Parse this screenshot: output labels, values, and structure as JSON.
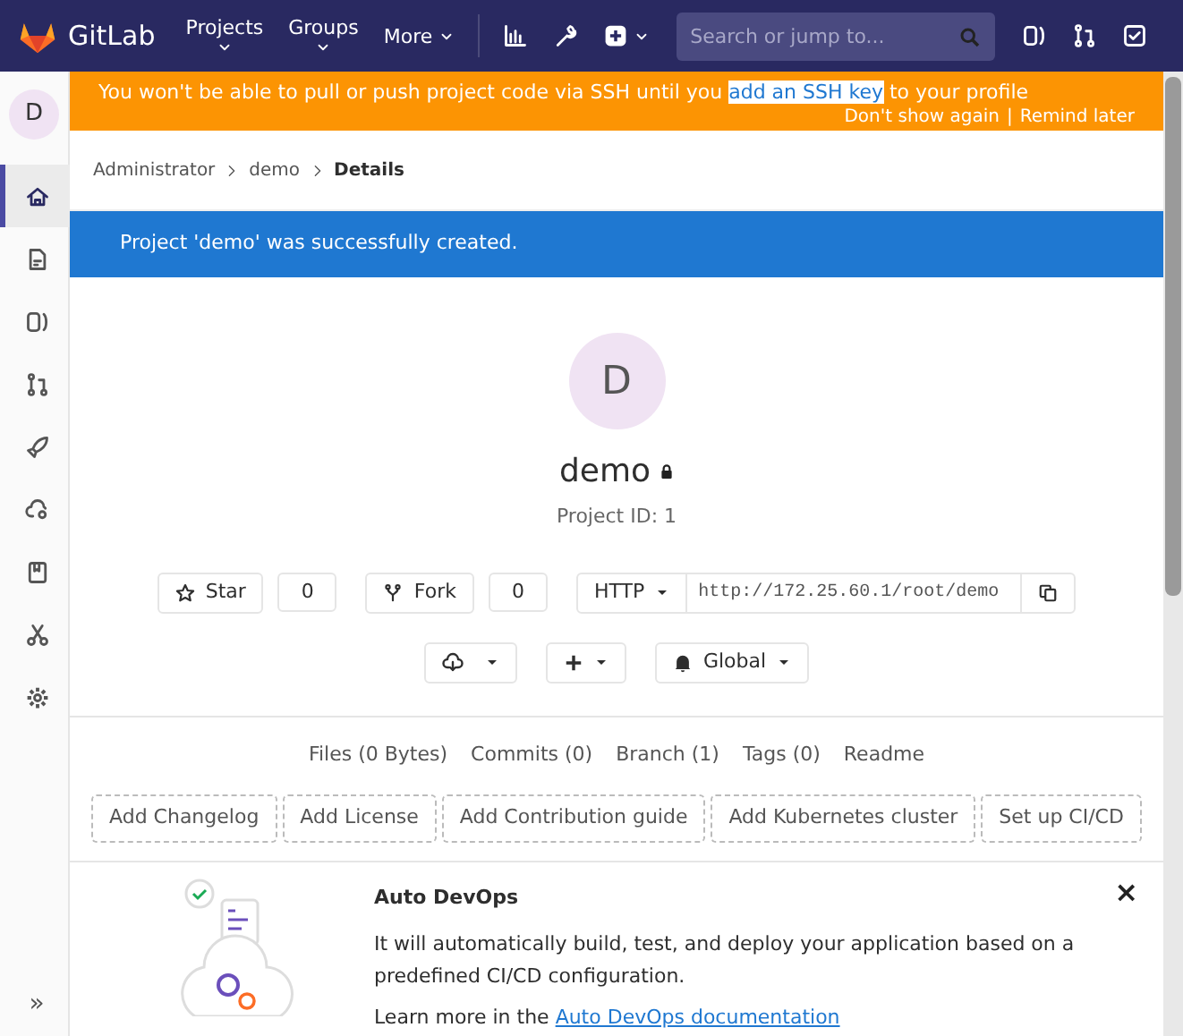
{
  "navbar": {
    "brand": "GitLab",
    "menus": [
      {
        "label": "Projects",
        "kind": "stacked"
      },
      {
        "label": "Groups",
        "kind": "stacked"
      },
      {
        "label": "More",
        "kind": "inline"
      }
    ],
    "search": {
      "placeholder": "Search or jump to..."
    }
  },
  "sidebar": {
    "avatar": "D",
    "items": [
      {
        "kind": "home",
        "selected": true
      },
      {
        "kind": "file",
        "selected": false
      },
      {
        "kind": "issues",
        "selected": false
      },
      {
        "kind": "merge",
        "selected": false
      },
      {
        "kind": "rocket",
        "selected": false
      },
      {
        "kind": "cloud",
        "selected": false
      },
      {
        "kind": "book",
        "selected": false
      },
      {
        "kind": "scissors",
        "selected": false
      },
      {
        "kind": "gear",
        "selected": false
      }
    ],
    "collapse": "»"
  },
  "ssh_alert": {
    "before": "You won't be able to pull or push project code via SSH until you",
    "link": "add an SSH key",
    "after": "to your profile",
    "actions": [
      "Don't show again",
      "Remind later"
    ],
    "separator": "|"
  },
  "breadcrumbs": [
    {
      "label": "Administrator",
      "current": false
    },
    {
      "label": "demo",
      "current": false
    },
    {
      "label": "Details",
      "current": true
    }
  ],
  "flash": "Project 'demo' was successfully created.",
  "project": {
    "avatar": "D",
    "name": "demo",
    "private": true,
    "id_label": "Project ID: 1"
  },
  "buttons": {
    "star": {
      "label": "Star",
      "count": "0"
    },
    "fork": {
      "label": "Fork",
      "count": "0"
    },
    "clone": {
      "protocol": "HTTP",
      "url": "http://172.25.60.1/root/demo"
    },
    "notification": "Global"
  },
  "stats": [
    "Files (0 Bytes)",
    "Commits (0)",
    "Branch (1)",
    "Tags (0)",
    "Readme"
  ],
  "add_buttons": [
    "Add Changelog",
    "Add License",
    "Add Contribution guide",
    "Add Kubernetes cluster",
    "Set up CI/CD"
  ],
  "auto_devops": {
    "title": "Auto DevOps",
    "body": "It will automatically build, test, and deploy your application based on a predefined CI/CD configuration.",
    "learn_more": "Learn more in the",
    "link": "Auto DevOps documentation",
    "close": "×"
  }
}
